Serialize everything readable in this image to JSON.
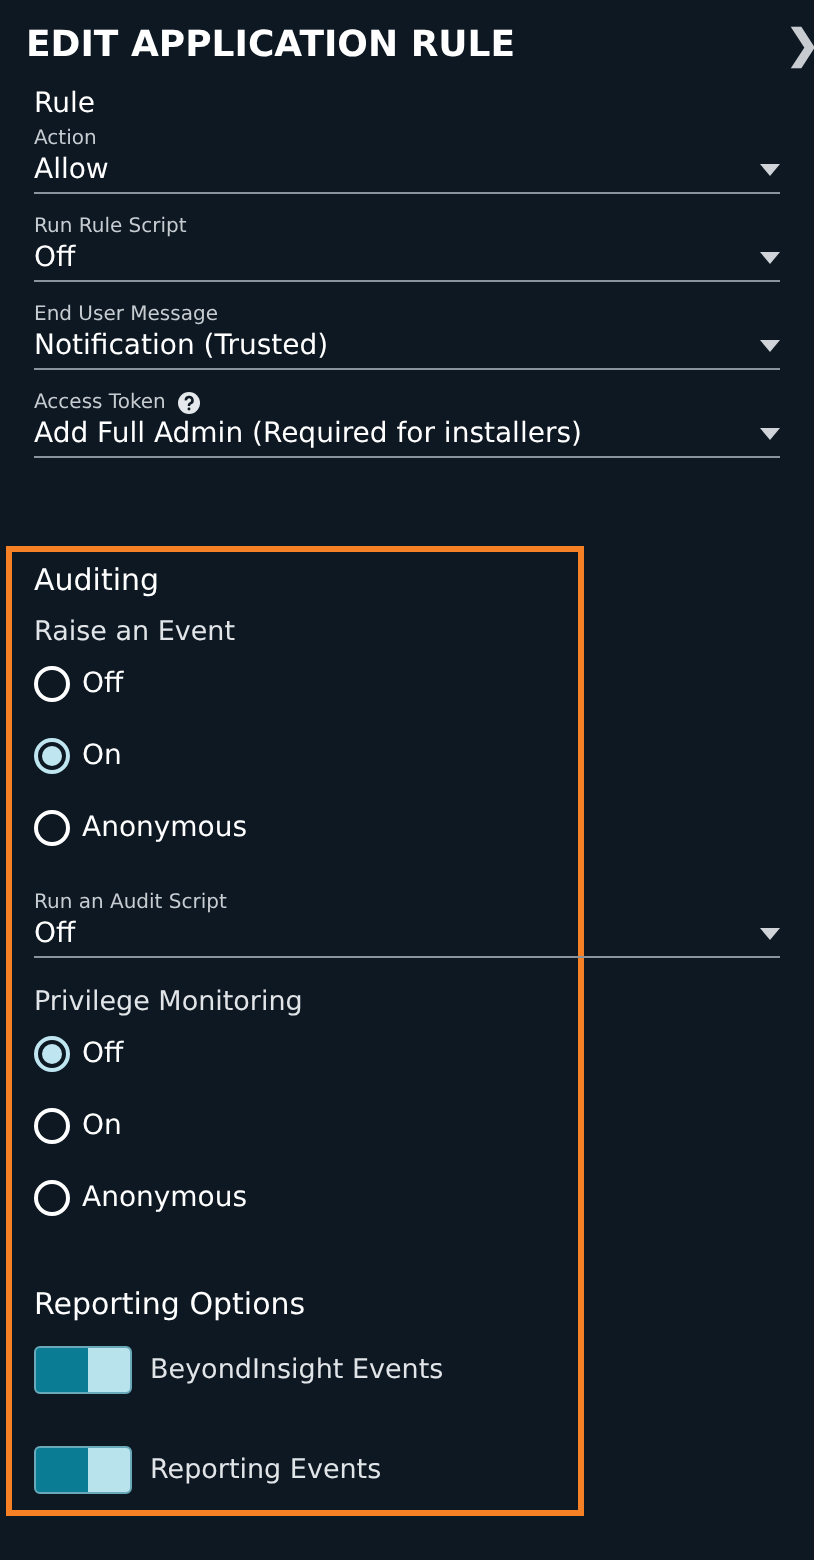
{
  "header": {
    "title": "EDIT APPLICATION RULE",
    "close": "❯"
  },
  "rule_section": {
    "title": "Rule",
    "selects": [
      {
        "label": "Action",
        "value": "Allow",
        "help": false
      },
      {
        "label": "Run Rule Script",
        "value": "Off",
        "help": false
      },
      {
        "label": "End User Message",
        "value": "Notification (Trusted)",
        "help": false
      },
      {
        "label": "Access Token",
        "value": "Add Full Admin (Required for installers)",
        "help": true
      }
    ]
  },
  "auditing": {
    "title": "Auditing",
    "raise_event": {
      "label": "Raise an Event",
      "options": [
        {
          "label": "Off",
          "selected": false
        },
        {
          "label": "On",
          "selected": true
        },
        {
          "label": "Anonymous",
          "selected": false
        }
      ]
    },
    "audit_script": {
      "label": "Run an Audit Script",
      "value": "Off"
    },
    "privilege_monitoring": {
      "label": "Privilege Monitoring",
      "options": [
        {
          "label": "Off",
          "selected": true
        },
        {
          "label": "On",
          "selected": false
        },
        {
          "label": "Anonymous",
          "selected": false
        }
      ]
    },
    "reporting": {
      "title": "Reporting Options",
      "toggles": [
        {
          "label": "BeyondInsight Events",
          "on": true
        },
        {
          "label": "Reporting Events",
          "on": true
        }
      ]
    }
  }
}
